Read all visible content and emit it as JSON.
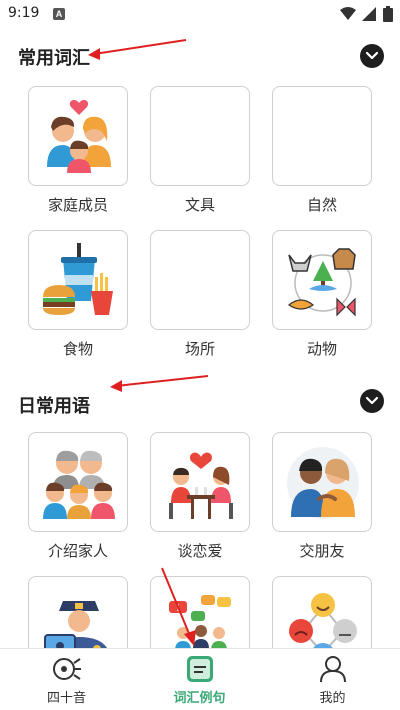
{
  "status_bar": {
    "time": "9:19",
    "notification_badge": "A"
  },
  "sections": [
    {
      "title": "常用词汇",
      "collapse_icon": "chevron-down-icon",
      "items": [
        {
          "label": "家庭成员",
          "icon": "family-icon"
        },
        {
          "label": "文具",
          "icon": ""
        },
        {
          "label": "自然",
          "icon": ""
        },
        {
          "label": "食物",
          "icon": "fast-food-icon"
        },
        {
          "label": "场所",
          "icon": ""
        },
        {
          "label": "动物",
          "icon": "animals-icon"
        }
      ]
    },
    {
      "title": "日常用语",
      "collapse_icon": "chevron-down-icon",
      "items": [
        {
          "label": "介绍家人",
          "icon": "family-group-icon"
        },
        {
          "label": "谈恋爱",
          "icon": "dating-couple-icon"
        },
        {
          "label": "交朋友",
          "icon": "friends-icon"
        },
        {
          "label": "",
          "icon": "police-officer-icon"
        },
        {
          "label": "",
          "icon": "meeting-chat-icon"
        },
        {
          "label": "",
          "icon": "emotions-icon"
        }
      ]
    }
  ],
  "bottom_nav": [
    {
      "label": "四十音",
      "icon": "kana-icon",
      "active": false
    },
    {
      "label": "词汇例句",
      "icon": "vocabulary-icon",
      "active": true
    },
    {
      "label": "我的",
      "icon": "profile-icon",
      "active": false
    }
  ],
  "colors": {
    "accent": "#3aa877",
    "annotation_arrow": "#e02020",
    "chevron_bg": "#1e1e1e"
  }
}
